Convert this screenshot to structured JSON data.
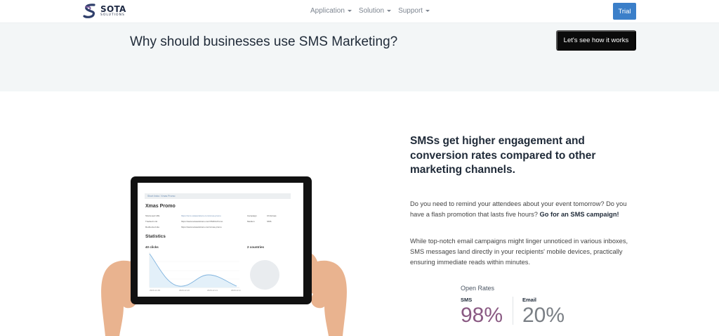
{
  "nav": {
    "logo_name": "SOTA",
    "logo_sub": "SOLUTIONS",
    "links": [
      {
        "label": "Application"
      },
      {
        "label": "Solution"
      },
      {
        "label": "Support"
      }
    ],
    "trial_label": "Trial"
  },
  "hero": {
    "title": "Why should businesses use SMS Marketing?",
    "cta_label": "Let's see how it works"
  },
  "tablet_screen": {
    "breadcrumb": "Short links / Xmas Promo",
    "title": "Xmas Promo",
    "rows": [
      {
        "label": "Shortened URL",
        "value": "https://sms.sotasolutions.com/xmas-promo"
      },
      {
        "label": "Tracked Link",
        "value": "https://www.sotasolutions.com/XMAS-Promo"
      },
      {
        "label": "Redirected site",
        "value": "https://www.sotasolutions.com/xmas-promo"
      }
    ],
    "side_labels": [
      "Campaign",
      "Medium"
    ],
    "side_values": [
      "Christmas",
      "SMS"
    ],
    "stats_title": "Statistics",
    "clicks": "40 clicks",
    "countries": "2 countries",
    "x_labels": [
      "2020-12-09",
      "2020-12-10",
      "2020-12-11",
      "2020-12-12"
    ]
  },
  "content": {
    "headline": "SMSs get higher engagement and conversion rates compared to other marketing channels.",
    "para1_text": "Do you need to remind your attendees about your event tomorrow? Do you have a flash promotion that lasts five hours? ",
    "para1_bold": "Go for an SMS campaign!",
    "para2": "While top-notch email campaigns might linger unnoticed in various inboxes, SMS messages land directly in your recipients' mobile devices, practically ensuring immediate reads within minutes."
  },
  "open_rates": {
    "title": "Open Rates",
    "sms_label": "SMS",
    "sms_value": "98%",
    "email_label": "Email",
    "email_value": "20%"
  },
  "colors": {
    "trial_button": "#3b7fc9",
    "sms_rate": "#8a5a83",
    "email_rate": "#7a7f85",
    "band_bg": "#f3f6f7"
  }
}
